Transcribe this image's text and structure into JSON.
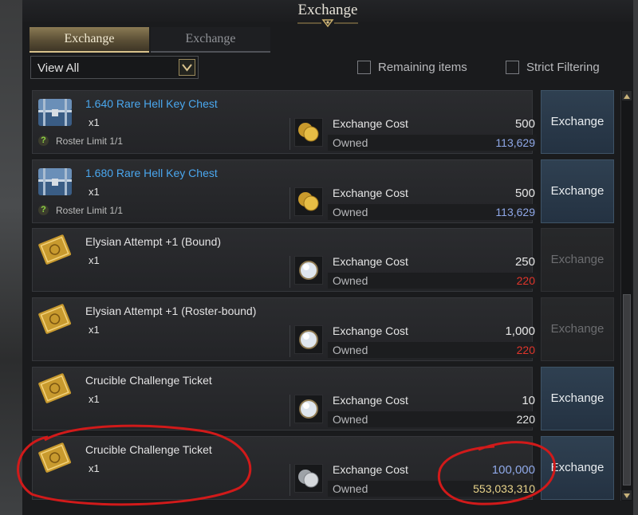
{
  "window": {
    "title": "Exchange"
  },
  "tabs": [
    {
      "label": "Exchange",
      "active": true
    },
    {
      "label": "Exchange",
      "active": false
    }
  ],
  "filter": {
    "selected": "View All"
  },
  "checkboxes": [
    {
      "label": "Remaining items",
      "checked": false
    },
    {
      "label": "Strict Filtering",
      "checked": false
    }
  ],
  "labels": {
    "cost": "Exchange Cost",
    "owned": "Owned",
    "button": "Exchange"
  },
  "items": [
    {
      "name": "1.640 Rare Hell Key Chest",
      "qty": "x1",
      "limit": "Roster Limit 1/1",
      "icon": "chest-icon",
      "currency_icon": "gold-coins-icon",
      "cost": "500",
      "owned": "113,629",
      "name_color": "blue",
      "owned_color": "#8fa8e8",
      "enabled": true
    },
    {
      "name": "1.680 Rare Hell Key Chest",
      "qty": "x1",
      "limit": "Roster Limit 1/1",
      "icon": "chest-icon",
      "currency_icon": "gold-coins-icon",
      "cost": "500",
      "owned": "113,629",
      "name_color": "blue",
      "owned_color": "#8fa8e8",
      "enabled": true
    },
    {
      "name": "Elysian Attempt +1 (Bound)",
      "qty": "x1",
      "limit": "",
      "icon": "ticket-icon",
      "currency_icon": "crystal-orb-icon",
      "cost": "250",
      "owned": "220",
      "name_color": "white",
      "owned_color": "#e0352b",
      "enabled": false
    },
    {
      "name": "Elysian Attempt +1 (Roster-bound)",
      "qty": "x1",
      "limit": "",
      "icon": "ticket-icon",
      "currency_icon": "crystal-orb-icon",
      "cost": "1,000",
      "owned": "220",
      "name_color": "white",
      "owned_color": "#e0352b",
      "enabled": false
    },
    {
      "name": "Crucible Challenge Ticket",
      "qty": "x1",
      "limit": "",
      "icon": "ticket-icon",
      "currency_icon": "crystal-orb-icon",
      "cost": "10",
      "owned": "220",
      "name_color": "white",
      "owned_color": "#e6e6e6",
      "enabled": true
    },
    {
      "name": "Crucible Challenge Ticket",
      "qty": "x1",
      "limit": "",
      "icon": "ticket-icon",
      "currency_icon": "silver-coins-icon",
      "cost": "100,000",
      "owned": "553,033,310",
      "name_color": "white",
      "cost_color": "#8fa8e8",
      "owned_color": "#e9d48a",
      "enabled": true
    }
  ],
  "colors": {
    "accent_gold": "#d8c28c",
    "button_blue": "#2f4051",
    "annotation_red": "#d11a1a"
  }
}
